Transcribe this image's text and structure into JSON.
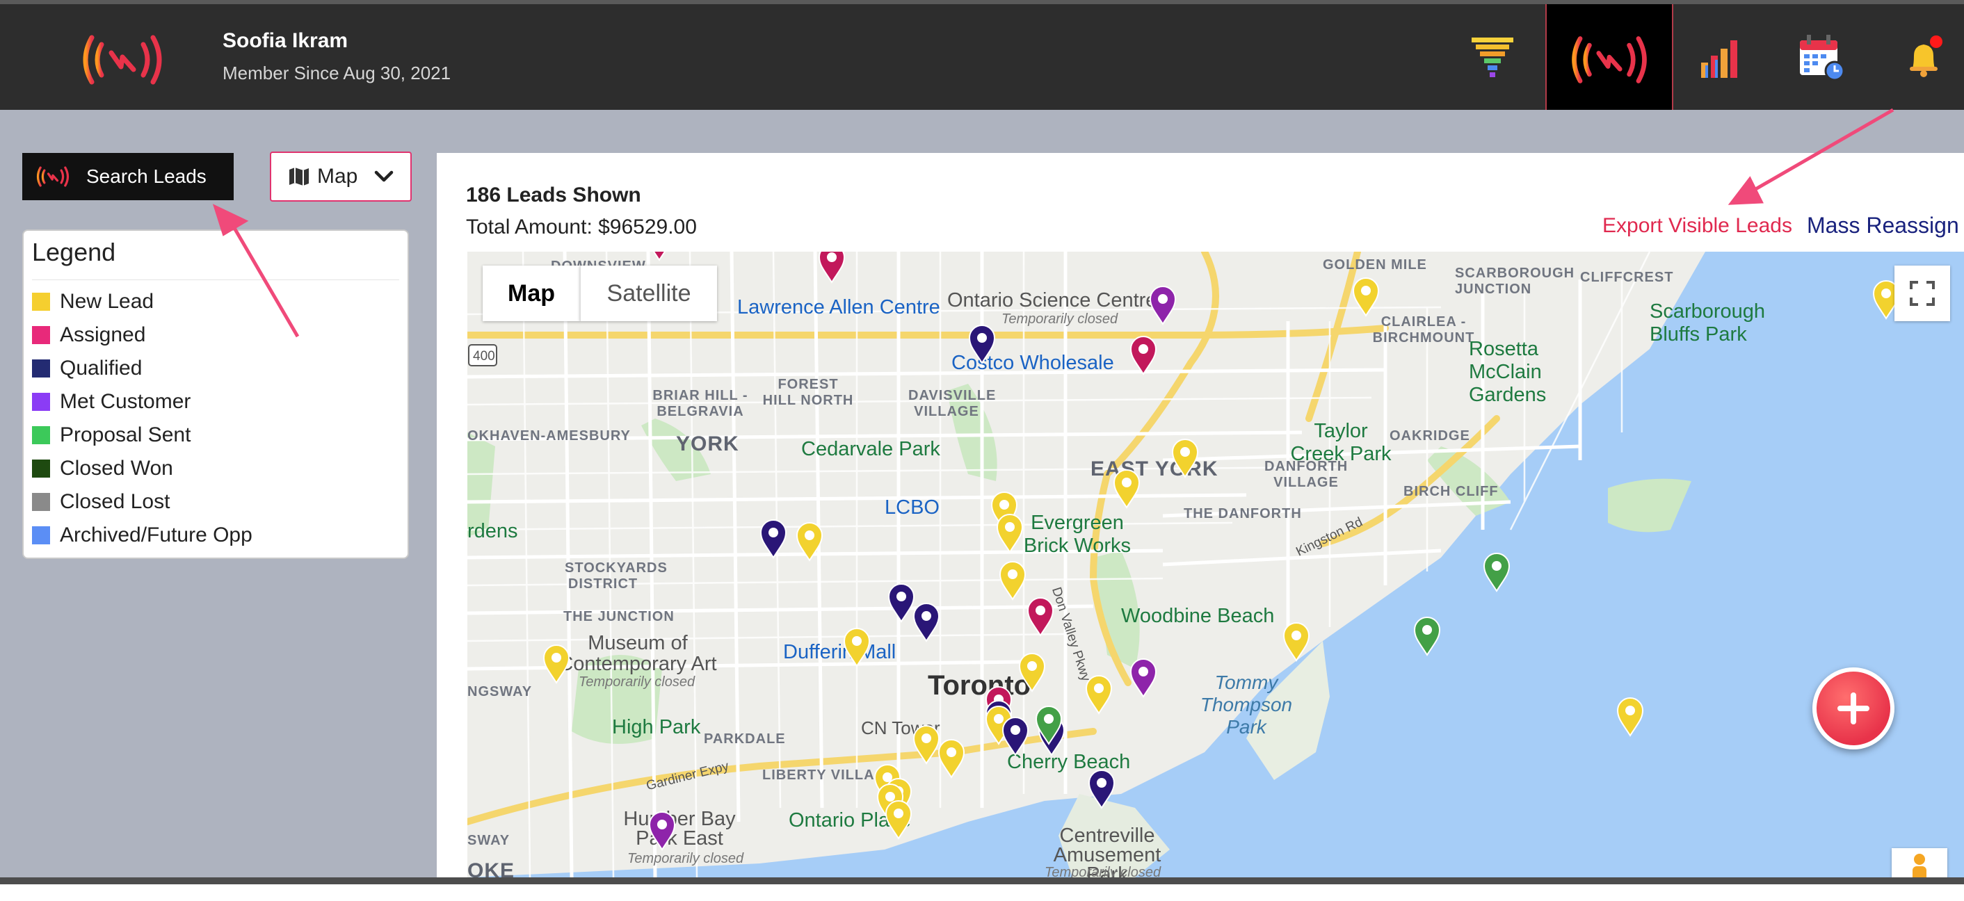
{
  "header": {
    "user_name": "Soofia Ikram",
    "member_since": "Member Since Aug 30, 2021",
    "icons": [
      "brand-logo-icon",
      "funnel-icon",
      "signal-icon",
      "bar-chart-icon",
      "calendar-icon",
      "bell-icon"
    ],
    "notification_dot_color": "#ff1a1a"
  },
  "sidebar": {
    "search_button_label": "Search Leads",
    "view_select_value": "Map",
    "legend": {
      "title": "Legend",
      "items": [
        {
          "label": "New Lead",
          "color": "#f5cf2f"
        },
        {
          "label": "Assigned",
          "color": "#e8297a"
        },
        {
          "label": "Qualified",
          "color": "#232b72"
        },
        {
          "label": "Met Customer",
          "color": "#8b3cf5"
        },
        {
          "label": "Proposal Sent",
          "color": "#3cc95a"
        },
        {
          "label": "Closed Won",
          "color": "#1e4a10"
        },
        {
          "label": "Closed Lost",
          "color": "#8a8a8a"
        },
        {
          "label": "Archived/Future Opp",
          "color": "#5b8ef5"
        }
      ]
    }
  },
  "main": {
    "leads_shown": "186 Leads Shown",
    "total_amount": "Total Amount: $96529.00",
    "export_label": "Export Visible Leads",
    "mass_reassign_label": "Mass Reassign"
  },
  "map": {
    "map_type_map": "Map",
    "map_type_satellite": "Satellite",
    "labels": {
      "york": "YORK",
      "east_york": "EAST YORK",
      "toronto": "Toronto",
      "golden_mile": "GOLDEN MILE",
      "scarborough_junction": "SCARBOROUGH JUNCTION",
      "cliffcrest": "CLIFFCREST",
      "clairlea": "CLAIRLEA - BIRCHMOUNT",
      "lawrence": "Lawrence Allen Centre",
      "ontario_science": "Ontario Science Centre",
      "temporarily_closed": "Temporarily closed",
      "costco": "Costco Wholesale",
      "briar_hill": "BRIAR HILL - BELGRAVIA",
      "forest_hill": "FOREST HILL NORTH",
      "davisville": "DAVISVILLE VILLAGE",
      "scarborough_bluffs": "Scarborough Bluffs Park",
      "rosetta": "Rosetta McClain Gardens",
      "oakwood": "OKHAVEN-AMESBURY",
      "cedarvale": "Cedarvale Park",
      "taylor_creek": "Taylor Creek Park",
      "oakridge": "OAKRIDGE",
      "danforth_village": "DANFORTH VILLAGE",
      "birch_cliff": "BIRCH CLIFF",
      "lcbo": "LCBO",
      "evergreen": "Evergreen Brick Works",
      "the_danforth": "THE DANFORTH",
      "kingston_rd": "Kingston Rd",
      "gardens": "rdens",
      "stockyards": "STOCKYARDS DISTRICT",
      "don_valley": "Don Valley Pkwy",
      "woodbine": "Woodbine Beach",
      "the_junction": "THE JUNCTION",
      "museum": "Museum of Contemporary Art",
      "dufferin": "Dufferin Mall",
      "ngsway": "NGSWAY",
      "tommy_thompson": "Tommy Thompson Park",
      "high_park": "High Park",
      "parkdale": "PARKDALE",
      "cn_tower": "CN Tower",
      "liberty_village": "LIBERTY VILLAGE",
      "gardiner": "Gardiner Expy",
      "cherry_beach": "Cherry Beach",
      "humber_bay": "Humber Bay Park East",
      "ontario_place": "Ontario Place",
      "centreville": "Centreville Amusement Park",
      "sway": "SWAY",
      "oke": "OKE",
      "downsview": "DOWNSVIEW",
      "hwy_400": "400"
    },
    "pins": [
      {
        "status": "Assigned"
      },
      {
        "status": "Assigned"
      },
      {
        "status": "Assigned"
      },
      {
        "status": "Assigned"
      },
      {
        "status": "Qualified"
      },
      {
        "status": "Met Customer"
      },
      {
        "status": "New Lead"
      },
      {
        "status": "New Lead"
      },
      {
        "status": "Proposal Sent"
      },
      {
        "status": "Met Customer"
      }
    ]
  }
}
